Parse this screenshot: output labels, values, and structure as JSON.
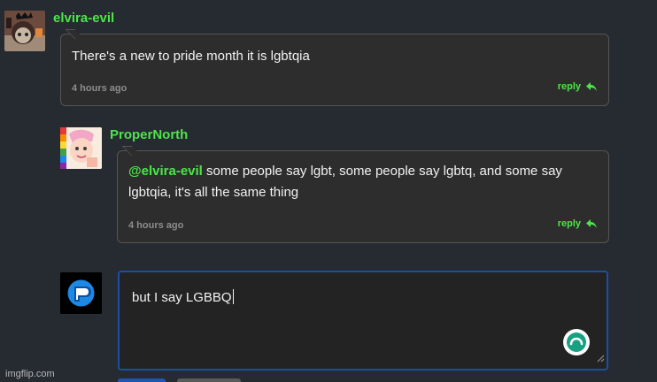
{
  "comments": [
    {
      "username": "elvira-evil",
      "text": "There's a new to pride month it is lgbtqia",
      "time": "4 hours ago",
      "reply_label": "reply"
    },
    {
      "username": "ProperNorth",
      "mention": "@elvira-evil",
      "text_line1": " some people say lgbt, some people say lgbtq, and some say",
      "text_line2": "lgbtqia, it's all the same thing",
      "time": "4 hours ago",
      "reply_label": "reply"
    }
  ],
  "reply_box": {
    "value": "but I say LGBBQ"
  },
  "watermark": "imgflip.com",
  "icons": {
    "reply": "reply-arrow-icon",
    "loader": "loading-spinner-icon",
    "resize": "resize-handle-icon"
  },
  "colors": {
    "background": "#262a31",
    "username": "#4ce54a",
    "bubble": "#2d2d2d",
    "focus_border": "#1c4fa3",
    "spinner": "#18a082"
  }
}
